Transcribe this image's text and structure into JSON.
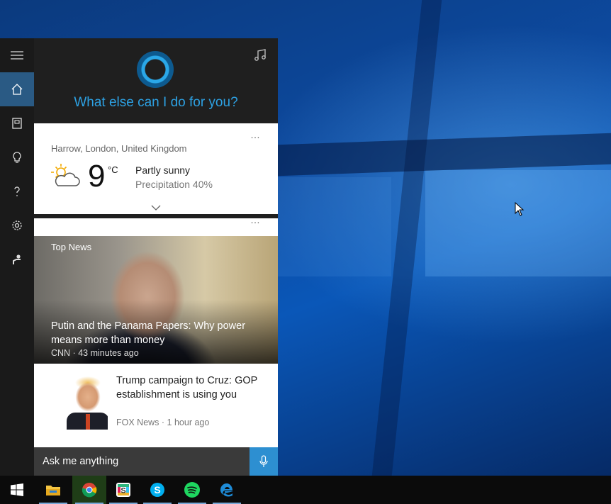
{
  "cortana": {
    "greeting": "What else can I do for you?",
    "rail_items": [
      "menu",
      "home",
      "notebook",
      "reminders",
      "help",
      "settings",
      "feedback"
    ]
  },
  "weather": {
    "location": "Harrow, London, United Kingdom",
    "temperature": "9",
    "unit": "°C",
    "condition": "Partly sunny",
    "precipitation": "Precipitation 40%",
    "more": "…"
  },
  "news": {
    "more": "…",
    "section_label": "Top News",
    "headline": {
      "title": "Putin and the Panama Papers: Why power means more than money",
      "meta": "CNN · 43 minutes ago"
    },
    "stories": [
      {
        "title": "Trump campaign to Cruz: GOP establishment is using you",
        "meta": "FOX News · 1 hour ago"
      }
    ]
  },
  "search": {
    "placeholder": "Ask me anything"
  },
  "taskbar": {
    "items": [
      "start",
      "file-explorer",
      "chrome",
      "slack",
      "skype",
      "spotify",
      "edge"
    ]
  },
  "colors": {
    "accent": "#2da1e3",
    "rail_active": "#2a5a84",
    "mic": "#2d8fd1"
  }
}
